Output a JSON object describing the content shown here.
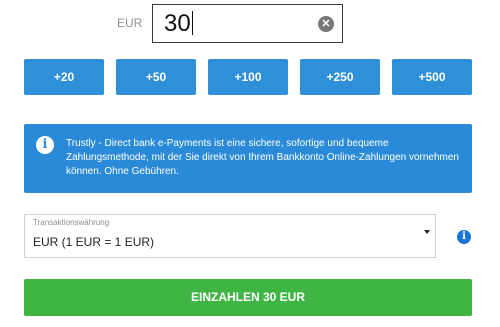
{
  "amount": {
    "currency_label": "EUR",
    "value": "30"
  },
  "quick_amounts": [
    "+20",
    "+50",
    "+100",
    "+250",
    "+500"
  ],
  "info": {
    "text": "Trustly - Direct bank e-Payments ist eine sichere, sofortige und bequeme Zahlungsmethode, mit der Sie direkt von Ihrem Bankkonto Online-Zahlungen vornehmen können. Ohne Gebühren."
  },
  "currency_select": {
    "caption": "Transaktionswährung",
    "selected": "EUR (1 EUR = 1 EUR)"
  },
  "deposit_button": {
    "label": "EINZAHLEN 30 EUR"
  },
  "colors": {
    "quick_button": "#2f8fd8",
    "info_background": "#2a8ad8",
    "deposit_button": "#41b544",
    "help_icon": "#1976d2"
  },
  "icons": {
    "clear": "close-circle-icon",
    "info": "info-icon",
    "dropdown": "triangle-down-icon",
    "help": "info-icon"
  }
}
